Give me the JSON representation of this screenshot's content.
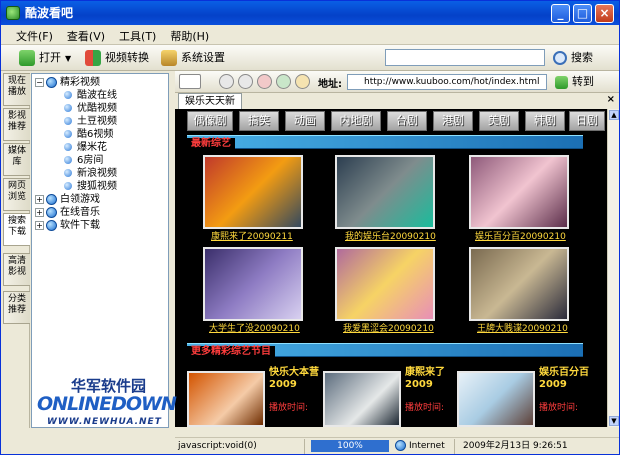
{
  "window": {
    "title": "酷波看吧",
    "min": "_",
    "max": "□",
    "close": "×"
  },
  "menu": [
    "文件(F)",
    "查看(V)",
    "工具(T)",
    "帮助(H)"
  ],
  "toolbar": {
    "open_label": "打开",
    "convert_label": "视频转换",
    "settings_label": "系统设置",
    "search_placeholder": "",
    "search_label": "搜索"
  },
  "left_tabs": [
    "现在播放",
    "影视推荐",
    "媒体库",
    "网页浏览",
    "搜索下载",
    "高清影视",
    "分类推荐"
  ],
  "tree": {
    "root": {
      "label": "精彩视频",
      "expander": "−"
    },
    "children": [
      "酷波在线",
      "优酷视频",
      "土豆视频",
      "酷6视频",
      "爆米花",
      "6房间",
      "新浪视频",
      "搜狐视频"
    ],
    "others": [
      {
        "label": "白领游戏",
        "expander": "+"
      },
      {
        "label": "在线音乐",
        "expander": "+"
      },
      {
        "label": "软件下载",
        "expander": "+"
      }
    ]
  },
  "nav": {
    "address_label": "地址:",
    "url": "http://www.kuuboo.com/hot/index.html",
    "go_label": "转到"
  },
  "tab": {
    "label": "娱乐天天新"
  },
  "page": {
    "categories": [
      "偶像剧",
      "搞笑",
      "动画",
      "内地剧",
      "台剧",
      "港剧",
      "美剧",
      "韩剧",
      "日剧"
    ],
    "section1_title": "最新综艺",
    "section2_title": "更多精彩综艺节目",
    "videos": [
      {
        "caption": "康熙来了20090211",
        "color": "#c0392b"
      },
      {
        "caption": "我的娱乐台20090210",
        "color": "#2c3e50"
      },
      {
        "caption": "娱乐百分百20090210",
        "color": "#8e5a7a"
      },
      {
        "caption": "大学生了没20090210",
        "color": "#5d4a8a"
      },
      {
        "caption": "我爱黑涩会20090210",
        "color": "#b06a9c"
      },
      {
        "caption": "王牌大贱谍20090210",
        "color": "#7a6a50"
      }
    ],
    "more": [
      {
        "title": "快乐大本营2009",
        "time_label": "播放时间:"
      },
      {
        "title": "康熙来了2009",
        "time_label": "播放时间:"
      },
      {
        "title": "娱乐百分百2009",
        "time_label": "播放时间:"
      }
    ]
  },
  "status": {
    "text": "javascript:void(0)",
    "progress": "100%",
    "zone": "Internet",
    "datetime": "2009年2月13日  9:26:51"
  },
  "watermark": {
    "cn": "华军软件园",
    "brand": "ONLINEDOWN",
    "url": "WWW.NEWHUA.NET"
  }
}
